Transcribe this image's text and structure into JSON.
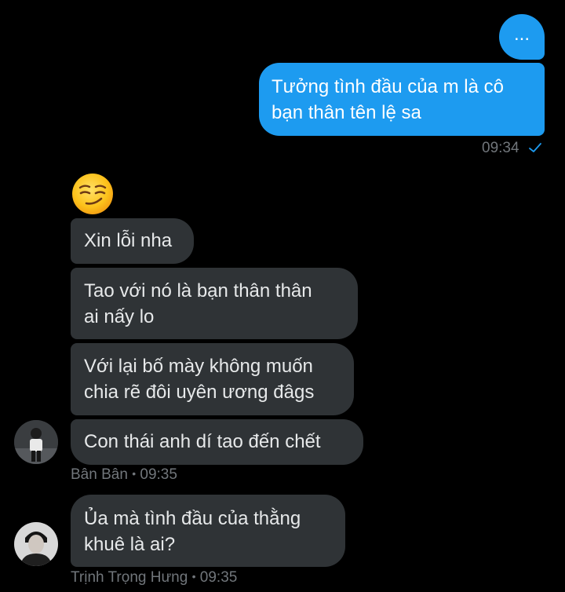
{
  "conversation": {
    "outgoing": [
      {
        "text": "..."
      },
      {
        "lines": [
          "Tưởng tình đầu của m là cô",
          "bạn thân tên lệ sa"
        ]
      }
    ],
    "outgoing_time": "09:34",
    "outgoing_status_icon": "check-icon",
    "reaction_emoji": "smirking-face",
    "incoming_group_1": {
      "messages": [
        {
          "lines": [
            "Xin lỗi nha"
          ]
        },
        {
          "lines": [
            "Tao với nó là bạn thân thân",
            "ai nấy lo"
          ]
        },
        {
          "lines": [
            "Với lại bố mày không muốn",
            "chia rẽ đôi uyên ương đâgs"
          ]
        },
        {
          "lines": [
            "Con thái anh dí tao đến chết"
          ]
        }
      ],
      "sender_name": "Bân Bân",
      "separator": "•",
      "time": "09:35"
    },
    "incoming_group_2": {
      "messages": [
        {
          "lines": [
            "Ủa mà tình đầu của thằng",
            "khuê là ai?"
          ]
        }
      ],
      "sender_name": "Trịnh Trọng Hưng",
      "separator": "•",
      "time": "09:35"
    }
  },
  "colors": {
    "background": "#000000",
    "outgoing_bubble": "#1d9bf0",
    "incoming_bubble": "#2f3336",
    "meta_text": "#71767b",
    "check": "#1d9bf0"
  }
}
